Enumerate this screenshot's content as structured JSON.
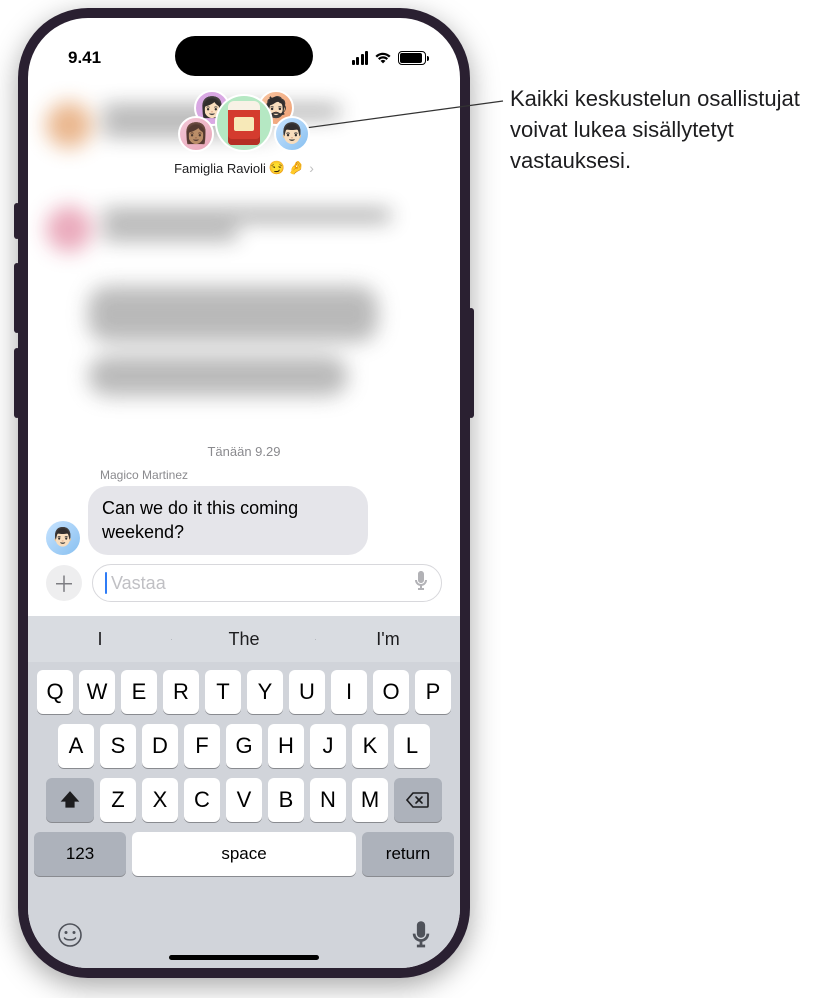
{
  "status": {
    "time": "9.41"
  },
  "group": {
    "name": "Famiglia Ravioli",
    "emoji1": "😏",
    "emoji2": "🤌"
  },
  "timestamp": "Tänään 9.29",
  "message": {
    "sender": "Magico Martinez",
    "text": "Can we do it this coming weekend?"
  },
  "compose": {
    "placeholder": "Vastaa"
  },
  "suggestions": [
    "I",
    "The",
    "I'm"
  ],
  "keyboard": {
    "row1": [
      "Q",
      "W",
      "E",
      "R",
      "T",
      "Y",
      "U",
      "I",
      "O",
      "P"
    ],
    "row2": [
      "A",
      "S",
      "D",
      "F",
      "G",
      "H",
      "J",
      "K",
      "L"
    ],
    "row3": [
      "Z",
      "X",
      "C",
      "V",
      "B",
      "N",
      "M"
    ],
    "numKey": "123",
    "space": "space",
    "return": "return"
  },
  "annotation": "Kaikki keskustelun osallistujat voivat lukea sisällytetyt vastauksesi."
}
